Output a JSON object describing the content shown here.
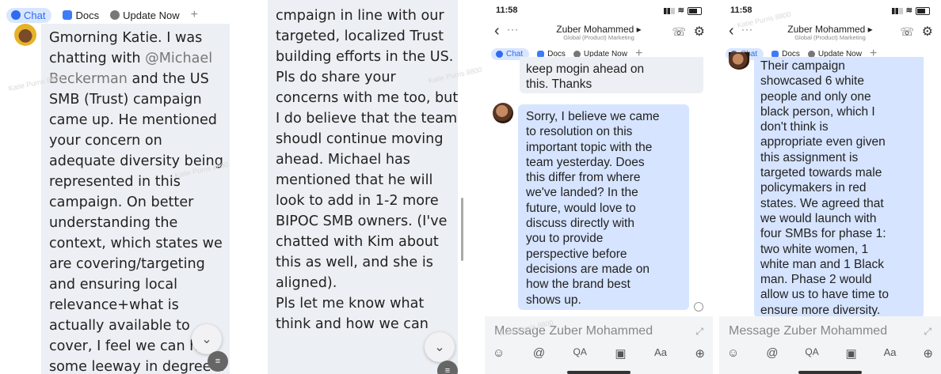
{
  "tabs": {
    "chat": "Chat",
    "docs": "Docs",
    "update": "Update Now",
    "plus": "+"
  },
  "panel1": {
    "lines": [
      "Gmorning Katie. I was",
      "chatting with @Michael",
      "Beckerman and the US",
      "SMB (Trust) campaign",
      "came up. He mentioned",
      "your concern on",
      "adequate diversity being",
      "represented in this",
      "campaign. On better",
      "understanding the",
      "context, which states we",
      "are covering/targeting",
      "and ensuring local",
      "relevance+what is",
      "actually available to",
      "cover, I feel we can ha",
      "some leeway in degree d"
    ]
  },
  "panel2": {
    "lines": [
      "cmpaign in line with our",
      "targeted, localized Trust",
      "building efforts in the US.",
      "Pls do share your",
      "concerns with me too, but",
      "I do believe that the team",
      "shoudl continue moving",
      "ahead. Michael has",
      "mentioned that he will",
      "look to add in 1-2 more",
      "BIPOC SMB owners. (I've",
      "chatted with Kim about",
      "this as well, and she is",
      "aligned).",
      "Pls let me know what",
      "think and how we can"
    ]
  },
  "phone": {
    "time": "11:58",
    "contact_name": "Zuber Mohammed ▸",
    "contact_sub": "Global (Product) Marketing",
    "message_placeholder": "Message Zuber Mohammed"
  },
  "panel3": {
    "top_lines": [
      "keep mogin ahead on",
      "this. Thanks"
    ],
    "reply_lines": [
      "Sorry, I believe we came",
      "to resolution on this",
      "important topic with the",
      "team yesterday. Does",
      "this differ from where",
      "we've landed? In the",
      "future, would love to",
      "discuss directly with",
      "you to provide",
      "perspective before",
      "decisions are made on",
      "how the brand best",
      "shows up."
    ]
  },
  "panel4": {
    "lines": [
      "Their campaign",
      "showcased 6 white",
      "people and only one",
      "black person, which I",
      "don't think is",
      "appropriate even given",
      "this assignment is",
      "targeted towards male",
      "policymakers in red",
      "states. We agreed that",
      "we would launch with",
      "four SMBs for phase 1:",
      "two white women, 1",
      "white man and 1 Black",
      "man. Phase 2 would",
      "allow us to have time to",
      "ensure more diversity."
    ]
  },
  "watermark": "Katie Purris 8800"
}
